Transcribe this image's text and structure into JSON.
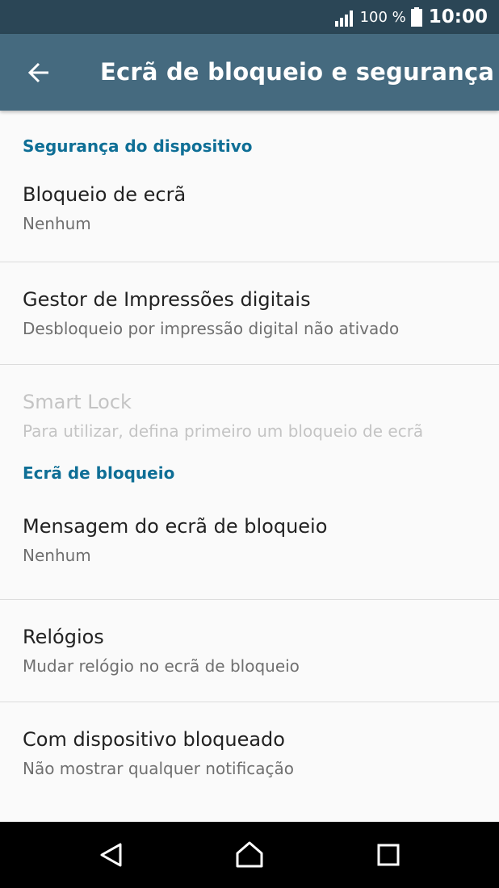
{
  "status_bar": {
    "battery_percent": "100 %",
    "time": "10:00"
  },
  "app_bar": {
    "title": "Ecrã de bloqueio e segurança"
  },
  "sections": [
    {
      "header": "Segurança do dispositivo",
      "items": [
        {
          "title": "Bloqueio de ecrã",
          "subtitle": "Nenhum",
          "enabled": true
        },
        {
          "title": "Gestor de Impressões digitais",
          "subtitle": "Desbloqueio por impressão digital não ativado",
          "enabled": true
        },
        {
          "title": "Smart Lock",
          "subtitle": "Para utilizar, defina primeiro um bloqueio de ecrã",
          "enabled": false
        }
      ]
    },
    {
      "header": "Ecrã de bloqueio",
      "items": [
        {
          "title": "Mensagem do ecrã de bloqueio",
          "subtitle": "Nenhum",
          "enabled": true
        },
        {
          "title": "Relógios",
          "subtitle": "Mudar relógio no ecrã de bloqueio",
          "enabled": true
        },
        {
          "title": "Com dispositivo bloqueado",
          "subtitle": "Não mostrar qualquer notificação",
          "enabled": true
        }
      ]
    }
  ],
  "icons": {
    "back": "arrow-left-icon",
    "signal": "signal-icon",
    "battery": "battery-icon",
    "nav_back": "triangle-back-icon",
    "nav_home": "home-icon",
    "nav_recents": "square-recents-icon"
  }
}
